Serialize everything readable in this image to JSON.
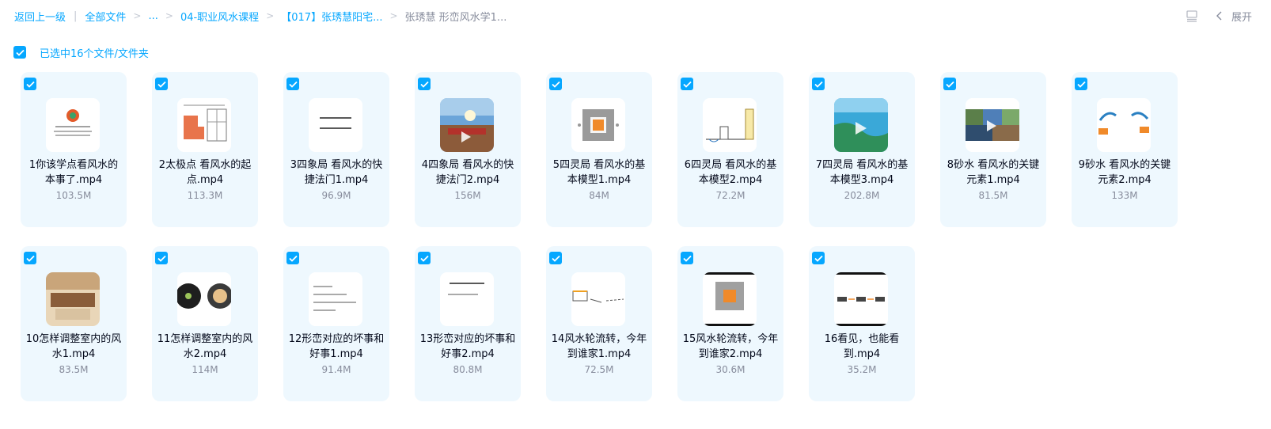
{
  "breadcrumb": {
    "back": "返回上一级",
    "all_files": "全部文件",
    "ellipsis": "...",
    "level1": "04-职业风水课程",
    "level2": "【017】张琇慧阳宅...",
    "current": "张琇慧 形峦风水学1..."
  },
  "toolbar": {
    "expand_label": "展开"
  },
  "selection": {
    "text": "已选中16个文件/文件夹"
  },
  "files": [
    {
      "name": "1你该学点看风水的本事了.mp4",
      "size": "103.5M",
      "thumb": "logo"
    },
    {
      "name": "2太极点 看风水的起点.mp4",
      "size": "113.3M",
      "thumb": "floorplan"
    },
    {
      "name": "3四象局 看风水的快捷法门1.mp4",
      "size": "96.9M",
      "thumb": "text"
    },
    {
      "name": "4四象局 看风水的快捷法门2.mp4",
      "size": "156M",
      "thumb": "palace"
    },
    {
      "name": "5四灵局 看风水的基本模型1.mp4",
      "size": "84M",
      "thumb": "square"
    },
    {
      "name": "6四灵局 看风水的基本模型2.mp4",
      "size": "72.2M",
      "thumb": "diagram"
    },
    {
      "name": "7四灵局 看风水的基本模型3.mp4",
      "size": "202.8M",
      "thumb": "coast"
    },
    {
      "name": "8砂水 看风水的关键元素1.mp4",
      "size": "81.5M",
      "thumb": "collage"
    },
    {
      "name": "9砂水 看风水的关键元素2.mp4",
      "size": "133M",
      "thumb": "swirl"
    },
    {
      "name": "10怎样调整室内的风水1.mp4",
      "size": "83.5M",
      "thumb": "room"
    },
    {
      "name": "11怎样调整室内的风水2.mp4",
      "size": "114M",
      "thumb": "circles"
    },
    {
      "name": "12形峦对应的坏事和好事1.mp4",
      "size": "91.4M",
      "thumb": "list"
    },
    {
      "name": "13形峦对应的坏事和好事2.mp4",
      "size": "80.8M",
      "thumb": "list2"
    },
    {
      "name": "14风水轮流转，今年到谁家1.mp4",
      "size": "72.5M",
      "thumb": "lines"
    },
    {
      "name": "15风水轮流转，今年到谁家2.mp4",
      "size": "30.6M",
      "thumb": "square2"
    },
    {
      "name": "16看见，也能看到.mp4",
      "size": "35.2M",
      "thumb": "arrows"
    }
  ],
  "colors": {
    "accent": "#06a7ff",
    "card_bg": "#eef8fe",
    "text": "#03081a",
    "muted": "#878c9c"
  },
  "icons": {
    "check": "check-icon",
    "list_view": "list-view-icon",
    "chevron": "chevron-left-icon"
  }
}
